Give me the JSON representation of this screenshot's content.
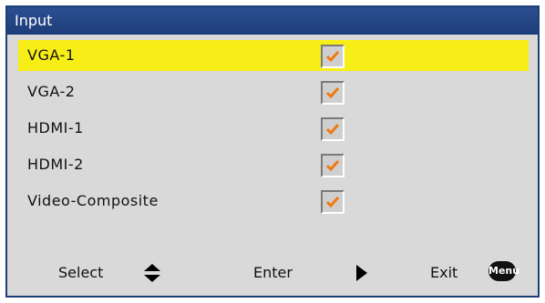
{
  "window": {
    "title": "Input"
  },
  "inputs": [
    {
      "label": "VGA-1",
      "checked": true,
      "selected": true
    },
    {
      "label": "VGA-2",
      "checked": true,
      "selected": false
    },
    {
      "label": "HDMI-1",
      "checked": true,
      "selected": false
    },
    {
      "label": "HDMI-2",
      "checked": true,
      "selected": false
    },
    {
      "label": "Video-Composite",
      "checked": true,
      "selected": false
    }
  ],
  "footer": {
    "select_label": "Select",
    "enter_label": "Enter",
    "exit_label": "Exit",
    "menu_badge": "Menu"
  },
  "colors": {
    "title_bar": "#1c3d79",
    "highlight": "#f8ee17",
    "checkmark": "#f07a10",
    "panel": "#d9d9d9"
  },
  "icons": {
    "select": "up-down-arrows-icon",
    "enter": "right-triangle-icon",
    "check": "checkmark-icon"
  }
}
